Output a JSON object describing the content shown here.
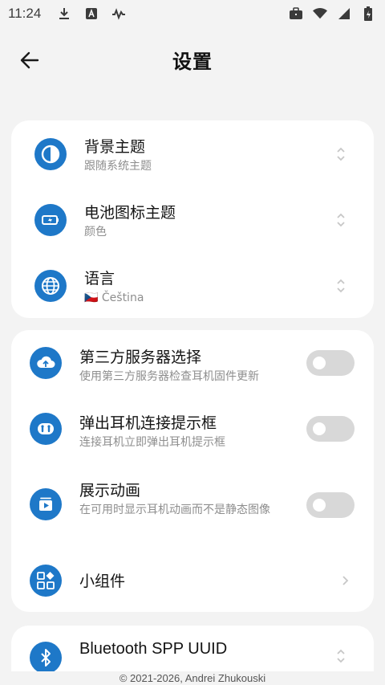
{
  "status_bar": {
    "time": "11:24",
    "left_icons": [
      "download-icon",
      "a-badge-icon",
      "activity-icon"
    ],
    "right_icons": [
      "briefcase-icon",
      "wifi-icon",
      "signal-icon",
      "battery-icon"
    ]
  },
  "header": {
    "title": "设置",
    "back_icon": "arrow-left-icon"
  },
  "appearance": {
    "items": [
      {
        "title": "背景主题",
        "subtitle": "跟随系统主题",
        "icon": "theme-contrast-icon"
      },
      {
        "title": "电池图标主题",
        "subtitle": "颜色",
        "icon": "battery-charge-icon"
      },
      {
        "title": "语言",
        "subtitle": "🇨🇿 Čeština",
        "icon": "globe-icon"
      }
    ]
  },
  "features": {
    "items": [
      {
        "title": "第三方服务器选择",
        "subtitle": "使用第三方服务器检查耳机固件更新",
        "icon": "cloud-upload-icon",
        "toggle": false
      },
      {
        "title": "弹出耳机连接提示框",
        "subtitle": "连接耳机立即弹出耳机提示框",
        "icon": "earbuds-icon",
        "toggle": false
      },
      {
        "title": "展示动画",
        "subtitle": "在可用时显示耳机动画而不是静态图像",
        "icon": "play-card-icon",
        "toggle": false
      },
      {
        "title": "小组件",
        "icon": "widgets-icon"
      }
    ]
  },
  "bluetooth": {
    "title": "Bluetooth SPP UUID",
    "icon": "bluetooth-icon"
  },
  "footer": {
    "copyright": "© 2021-2026, Andrei Zhukouski"
  },
  "colors": {
    "accent": "#1e78c8",
    "background": "#f3f3f3",
    "card": "#ffffff",
    "toggle_off": "#d8d8d8"
  }
}
